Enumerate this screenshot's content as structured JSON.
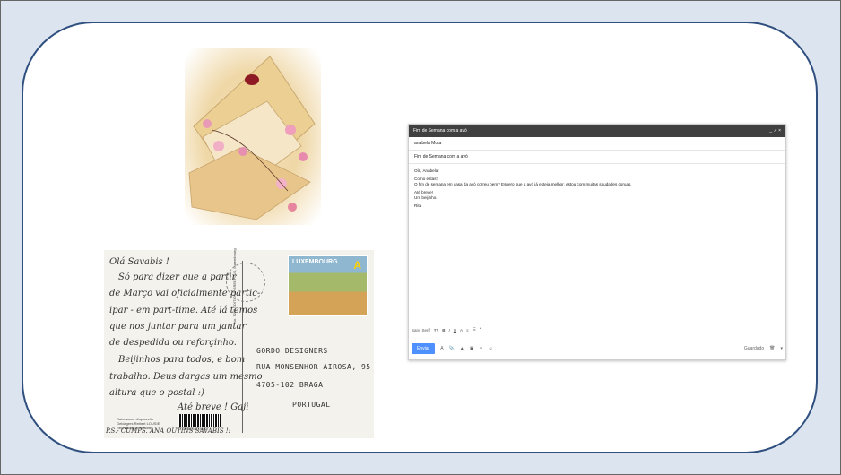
{
  "postcard": {
    "lines": [
      "Olá Savabis !",
      "Só para dizer que a partir",
      "de Março vai oficialmente partic-",
      "ipar - em part-time. Até lá temos",
      "que nos juntar para um jantar",
      "de despedida ou reforçinho.",
      "Beijinhos para todos, e bom",
      "trabalho. Deus dargas um mesmo",
      "altura que o postal :)",
      "Até breve ! Gaji"
    ],
    "footer": "P.S.- CUMPS. ANA   OUTINS SAVABIS !!",
    "stamp_country": "LUXEMBOURG",
    "stamp_letter": "A",
    "address": [
      "GORDO DESIGNERS",
      "RUA MONSENHOR AIROSA, 95",
      "4705-102   BRAGA",
      "PORTUGAL"
    ],
    "publisher": [
      "Rainmanne d'appareils",
      "Geldagers Reibert LOUSIE",
      "Reproduction interdite"
    ],
    "barcode_number": "3 319866 913533",
    "side_text": "No. 7292 EDITIONS GREEPLUS, Luxembourg"
  },
  "compose": {
    "title": "Fim de Semana com a avó",
    "window_controls": "_ ↗ ×",
    "to": "anabela Mota",
    "subject": "Fim de Semana com a avó",
    "body": [
      "Olá, Anabela!",
      "Como estás?",
      "O fim de semana em casa da avó correu bem? Espero que a avó já esteja melhor, estou com muitas saudades coruas.",
      "Até breve!",
      "Um beijinho.",
      "Rita"
    ],
    "format_font": "Sans Serif",
    "send_label": "Enviar",
    "saved_label": "Guardado"
  },
  "colors": {
    "slide_bg": "#dbe4ef",
    "border": "#2f4f7f",
    "header": "#404040",
    "send": "#4d90fe"
  }
}
